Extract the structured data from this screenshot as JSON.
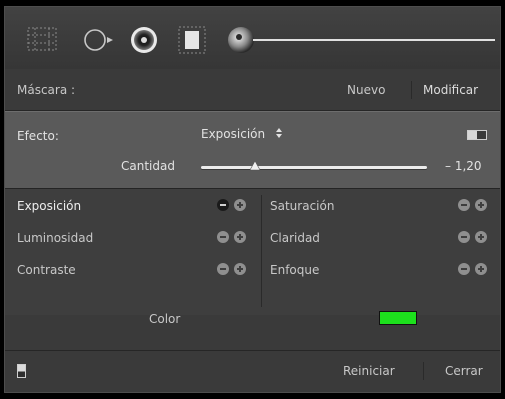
{
  "toolbar": {
    "tools": [
      "graduated-filter-icon",
      "radial-filter-icon",
      "spot-removal-icon",
      "red-eye-icon",
      "brush-icon"
    ]
  },
  "mask": {
    "label": "Máscara :",
    "new_label": "Nuevo",
    "edit_label": "Modificar"
  },
  "effect": {
    "label": "Efecto:",
    "selected": "Exposición",
    "amount_label": "Cantidad",
    "amount_value": "– 1,20",
    "amount_fraction": 0.24
  },
  "adjustments": {
    "left": [
      {
        "label": "Exposición",
        "active": true
      },
      {
        "label": "Luminosidad",
        "active": false
      },
      {
        "label": "Contraste",
        "active": false
      }
    ],
    "right": [
      {
        "label": "Saturación"
      },
      {
        "label": "Claridad"
      },
      {
        "label": "Enfoque"
      }
    ]
  },
  "color": {
    "label": "Color",
    "swatch": "#1de01d"
  },
  "footer": {
    "reset_label": "Reiniciar",
    "close_label": "Cerrar"
  },
  "colors": {
    "panel": "#3a3a3a",
    "effect_bg": "#5a5a5a",
    "text": "#c8c8c8"
  }
}
